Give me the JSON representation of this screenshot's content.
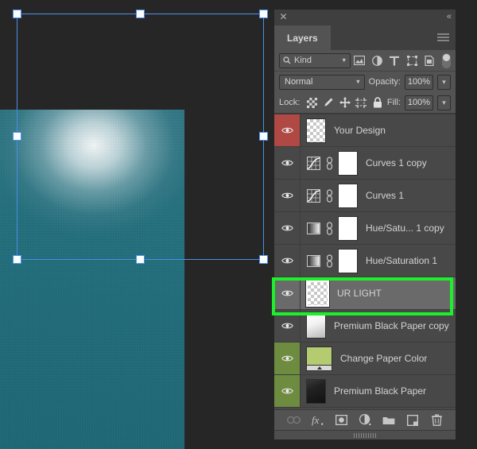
{
  "panel": {
    "title": "Layers",
    "close_icon": "close-icon",
    "collapse_icon": "collapse-double-arrow-icon",
    "menu_icon": "hamburger-menu-icon"
  },
  "filter_bar": {
    "kind_label": "Kind",
    "search_icon": "search-icon",
    "caret": "⌄",
    "icons": [
      {
        "name": "filter-pixel-layers-icon"
      },
      {
        "name": "filter-adjustment-layers-icon"
      },
      {
        "name": "filter-type-layers-icon"
      },
      {
        "name": "filter-shape-layers-icon"
      },
      {
        "name": "filter-smart-object-icon"
      }
    ],
    "toggle_name": "filter-enable-toggle"
  },
  "blend_bar": {
    "blend_mode": "Normal",
    "opacity_label": "Opacity:",
    "opacity_value": "100%"
  },
  "lock_bar": {
    "lock_label": "Lock:",
    "fill_label": "Fill:",
    "fill_value": "100%",
    "icons": [
      {
        "name": "lock-transparent-pixels-icon"
      },
      {
        "name": "lock-image-pixels-icon"
      },
      {
        "name": "lock-position-icon"
      },
      {
        "name": "lock-artboard-nesting-icon"
      },
      {
        "name": "lock-all-icon"
      }
    ]
  },
  "layers": [
    {
      "name": "Your Design",
      "visible": true,
      "eye_style": "red",
      "thumb": "checker",
      "selected": false,
      "has_mask": false,
      "adjustment_icon": null
    },
    {
      "name": "Curves 1 copy",
      "visible": true,
      "eye_style": "normal",
      "thumb": "white",
      "selected": false,
      "has_mask": true,
      "adjustment_icon": "curves-adjustment-icon"
    },
    {
      "name": "Curves 1",
      "visible": true,
      "eye_style": "normal",
      "thumb": "white",
      "selected": false,
      "has_mask": true,
      "adjustment_icon": "curves-adjustment-icon"
    },
    {
      "name": "Hue/Satu... 1 copy",
      "visible": true,
      "eye_style": "normal",
      "thumb": "white",
      "selected": false,
      "has_mask": true,
      "adjustment_icon": "hue-saturation-adjustment-icon"
    },
    {
      "name": "Hue/Saturation 1",
      "visible": true,
      "eye_style": "normal",
      "thumb": "white",
      "selected": false,
      "has_mask": true,
      "adjustment_icon": "hue-saturation-adjustment-icon"
    },
    {
      "name": "UR LIGHT",
      "visible": true,
      "eye_style": "normal",
      "thumb": "checker-selected",
      "selected": true,
      "has_mask": false,
      "adjustment_icon": null
    },
    {
      "name": "Premium Black Paper copy",
      "visible": true,
      "eye_style": "normal",
      "thumb": "gradient-white",
      "selected": false,
      "has_mask": false,
      "adjustment_icon": null
    },
    {
      "name": "Change Paper Color",
      "visible": true,
      "eye_style": "green",
      "thumb": "solid-green",
      "selected": false,
      "has_mask": false,
      "adjustment_icon": null
    },
    {
      "name": "Premium Black Paper",
      "visible": true,
      "eye_style": "green",
      "thumb": "black",
      "selected": false,
      "has_mask": false,
      "adjustment_icon": null
    }
  ],
  "footer": {
    "icons": [
      {
        "name": "link-layers-icon",
        "enabled": false
      },
      {
        "name": "layer-style-fx-icon",
        "enabled": true
      },
      {
        "name": "add-layer-mask-icon",
        "enabled": true
      },
      {
        "name": "new-adjustment-layer-icon",
        "enabled": true
      },
      {
        "name": "new-group-icon",
        "enabled": true
      },
      {
        "name": "new-layer-icon",
        "enabled": true
      },
      {
        "name": "delete-layer-icon",
        "enabled": true
      }
    ]
  },
  "canvas": {
    "document_name": "teal-paper-document",
    "background_color": "#262626",
    "paper_color": "#1f6b7a",
    "selection_color": "#4a90e8",
    "highlight_color": "#1bf02a"
  }
}
